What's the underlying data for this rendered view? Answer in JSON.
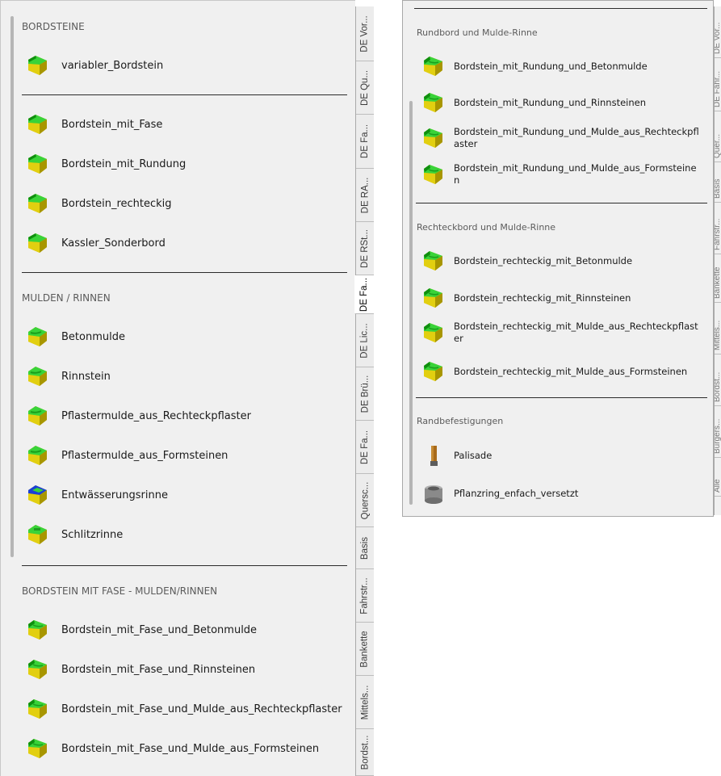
{
  "left_panel": {
    "groups": [
      {
        "title": "BORDSTEINE",
        "items": [
          {
            "label": "variabler_Bordstein",
            "icon": "curb-green-icon"
          }
        ]
      },
      {
        "title": "",
        "items": [
          {
            "label": "Bordstein_mit_Fase",
            "icon": "curb-green-icon"
          },
          {
            "label": "Bordstein_mit_Rundung",
            "icon": "curb-green-icon"
          },
          {
            "label": "Bordstein_rechteckig",
            "icon": "curb-green-icon"
          },
          {
            "label": "Kassler_Sonderbord",
            "icon": "curb-green-icon"
          }
        ]
      },
      {
        "title": "MULDEN / RINNEN",
        "items": [
          {
            "label": "Betonmulde",
            "icon": "gutter-green-icon"
          },
          {
            "label": "Rinnstein",
            "icon": "gutter-green-icon"
          },
          {
            "label": "Pflastermulde_aus_Rechteckpflaster",
            "icon": "gutter-green-icon"
          },
          {
            "label": "Pflastermulde_aus_Formsteinen",
            "icon": "gutter-green-icon"
          },
          {
            "label": "Entwässerungsrinne",
            "icon": "drain-channel-icon"
          },
          {
            "label": "Schlitzrinne",
            "icon": "slot-channel-icon"
          }
        ]
      },
      {
        "title": "BORDSTEIN MIT FASE - MULDEN/RINNEN",
        "items": [
          {
            "label": "Bordstein_mit_Fase_und_Betonmulde",
            "icon": "curb-gutter-icon"
          },
          {
            "label": "Bordstein_mit_Fase_und_Rinnsteinen",
            "icon": "curb-gutter-icon"
          },
          {
            "label": "Bordstein_mit_Fase_und_Mulde_aus_Rechteckpflaster",
            "icon": "curb-gutter-icon"
          },
          {
            "label": "Bordstein_mit_Fase_und_Mulde_aus_Formsteinen",
            "icon": "curb-gutter-icon"
          }
        ]
      }
    ],
    "tabs": [
      {
        "label": "DE Vor..."
      },
      {
        "label": "DE Qu..."
      },
      {
        "label": "DE Fa..."
      },
      {
        "label": "DE RA..."
      },
      {
        "label": "DE RSt..."
      },
      {
        "label": "DE Fa...",
        "active": true
      },
      {
        "label": "DE Lic..."
      },
      {
        "label": "DE Brü..."
      },
      {
        "label": "DE Fa..."
      },
      {
        "label": "Quersc..."
      },
      {
        "label": "Basis"
      },
      {
        "label": "Fahrstr..."
      },
      {
        "label": "Bankette"
      },
      {
        "label": "Mittels..."
      },
      {
        "label": "Bordst..."
      }
    ]
  },
  "right_panel": {
    "groups": [
      {
        "title": "Rundbord und Mulde-Rinne",
        "items": [
          {
            "label": "Bordstein_mit_Rundung_und_Betonmulde",
            "icon": "curb-gutter-icon"
          },
          {
            "label": "Bordstein_mit_Rundung_und_Rinnsteinen",
            "icon": "curb-gutter-icon"
          },
          {
            "label": "Bordstein_mit_Rundung_und_Mulde_aus_Rechteckpflaster",
            "icon": "curb-gutter-icon"
          },
          {
            "label": "Bordstein_mit_Rundung_und_Mulde_aus_Formsteinen",
            "icon": "curb-gutter-icon"
          }
        ]
      },
      {
        "title": "Rechteckbord und Mulde-Rinne",
        "items": [
          {
            "label": "Bordstein_rechteckig_mit_Betonmulde",
            "icon": "curb-gutter-icon"
          },
          {
            "label": "Bordstein_rechteckig_mit_Rinnsteinen",
            "icon": "curb-gutter-icon"
          },
          {
            "label": "Bordstein_rechteckig_mit_Mulde_aus_Rechteckpflaster",
            "icon": "curb-gutter-icon"
          },
          {
            "label": "Bordstein_rechteckig_mit_Mulde_aus_Formsteinen",
            "icon": "curb-gutter-icon"
          }
        ]
      },
      {
        "title": "Randbefestigungen",
        "items": [
          {
            "label": "Palisade",
            "icon": "palisade-post-icon"
          },
          {
            "label": "Pflanzring_enfach_versetzt",
            "icon": "planting-ring-icon"
          }
        ]
      }
    ],
    "tabs": [
      {
        "label": "DE Vor..."
      },
      {
        "label": "DE Fahr..."
      },
      {
        "label": "Quer..."
      },
      {
        "label": "Basis"
      },
      {
        "label": "Fahrstr..."
      },
      {
        "label": "Bankette"
      },
      {
        "label": "Mittels..."
      },
      {
        "label": "Bordst..."
      },
      {
        "label": "Bürgers..."
      },
      {
        "label": "Alle"
      }
    ]
  },
  "colors": {
    "panel_bg": "#f0f0f0",
    "icon_green": "#2ecc2e",
    "icon_yellow": "#d8c600",
    "separator": "#2b2b2b"
  }
}
